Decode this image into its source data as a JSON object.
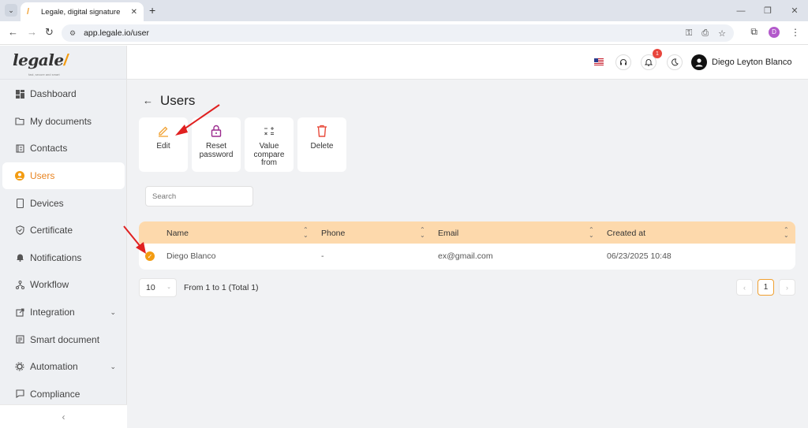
{
  "browser": {
    "tab_title": "Legale, digital signature",
    "url": "app.legale.io/user",
    "profile_initial": "D"
  },
  "logo": {
    "text": "legale",
    "tagline": "fast, secure and smart"
  },
  "sidebar": {
    "items": [
      {
        "label": "Dashboard",
        "icon": "dashboard-icon"
      },
      {
        "label": "My documents",
        "icon": "folder-icon"
      },
      {
        "label": "Contacts",
        "icon": "contacts-icon"
      },
      {
        "label": "Users",
        "icon": "user-circle-icon",
        "active": true
      },
      {
        "label": "Devices",
        "icon": "device-icon"
      },
      {
        "label": "Certificate",
        "icon": "shield-icon"
      },
      {
        "label": "Notifications",
        "icon": "bell-icon"
      },
      {
        "label": "Workflow",
        "icon": "workflow-icon"
      },
      {
        "label": "Integration",
        "icon": "external-link-icon",
        "expandable": true
      },
      {
        "label": "Smart document",
        "icon": "smart-document-icon"
      },
      {
        "label": "Automation",
        "icon": "automation-icon",
        "expandable": true
      },
      {
        "label": "Compliance",
        "icon": "chat-icon"
      }
    ],
    "collapse_label": "‹"
  },
  "topbar": {
    "notification_count": "1",
    "user_name": "Diego Leyton Blanco"
  },
  "page": {
    "title": "Users",
    "actions": [
      {
        "label": "Edit"
      },
      {
        "label": "Reset password"
      },
      {
        "label": "Value compare from"
      },
      {
        "label": "Delete"
      }
    ],
    "search_placeholder": "Search"
  },
  "table": {
    "columns": [
      "Name",
      "Phone",
      "Email",
      "Created at"
    ],
    "rows": [
      {
        "selected": true,
        "name": "Diego Blanco",
        "phone": "-",
        "email": "ex@gmail.com",
        "created_at": "06/23/2025 10:48"
      }
    ]
  },
  "pagination": {
    "page_size": "10",
    "info": "From 1 to 1 (Total 1)",
    "current_page": "1",
    "prev": "‹",
    "next": "›"
  },
  "colors": {
    "accent": "#f39c12",
    "header_row": "#fdd9ac",
    "annotation_arrow": "#e02020",
    "delete": "#e84b3c",
    "reset": "#9b2a8e"
  }
}
